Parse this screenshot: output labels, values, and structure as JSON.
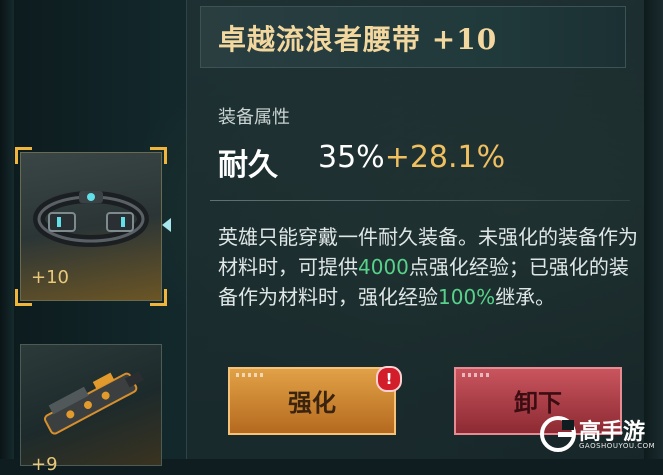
{
  "item": {
    "title": "卓越流浪者腰带 +10"
  },
  "attributes": {
    "section_label": "装备属性",
    "durability_label": "耐久",
    "durability_base": "35%",
    "durability_bonus": "+28.1%"
  },
  "description": {
    "part1": "英雄只能穿戴一件耐久装备。未强化的装备作为材料时，可提供",
    "exp_value": "4000",
    "part2": "点强化经验；已强化的装备作为材料时，强化经验",
    "inherit_value": "100%",
    "part3": "继承。"
  },
  "slots": [
    {
      "level": "+10",
      "icon": "belt-icon",
      "selected": true
    },
    {
      "level": "+9",
      "icon": "gun-icon",
      "selected": false
    }
  ],
  "buttons": {
    "enhance_label": "强化",
    "unequip_label": "卸下",
    "enhance_badge": "!"
  },
  "watermark": {
    "brand": "高手游",
    "domain": "GAOSHOUYOU.COM"
  },
  "colors": {
    "title": "#f2d79e",
    "bonus": "#f0c060",
    "highlight": "#57d28a",
    "enhance_button": "#d08a35",
    "unequip_button": "#b3434c"
  }
}
